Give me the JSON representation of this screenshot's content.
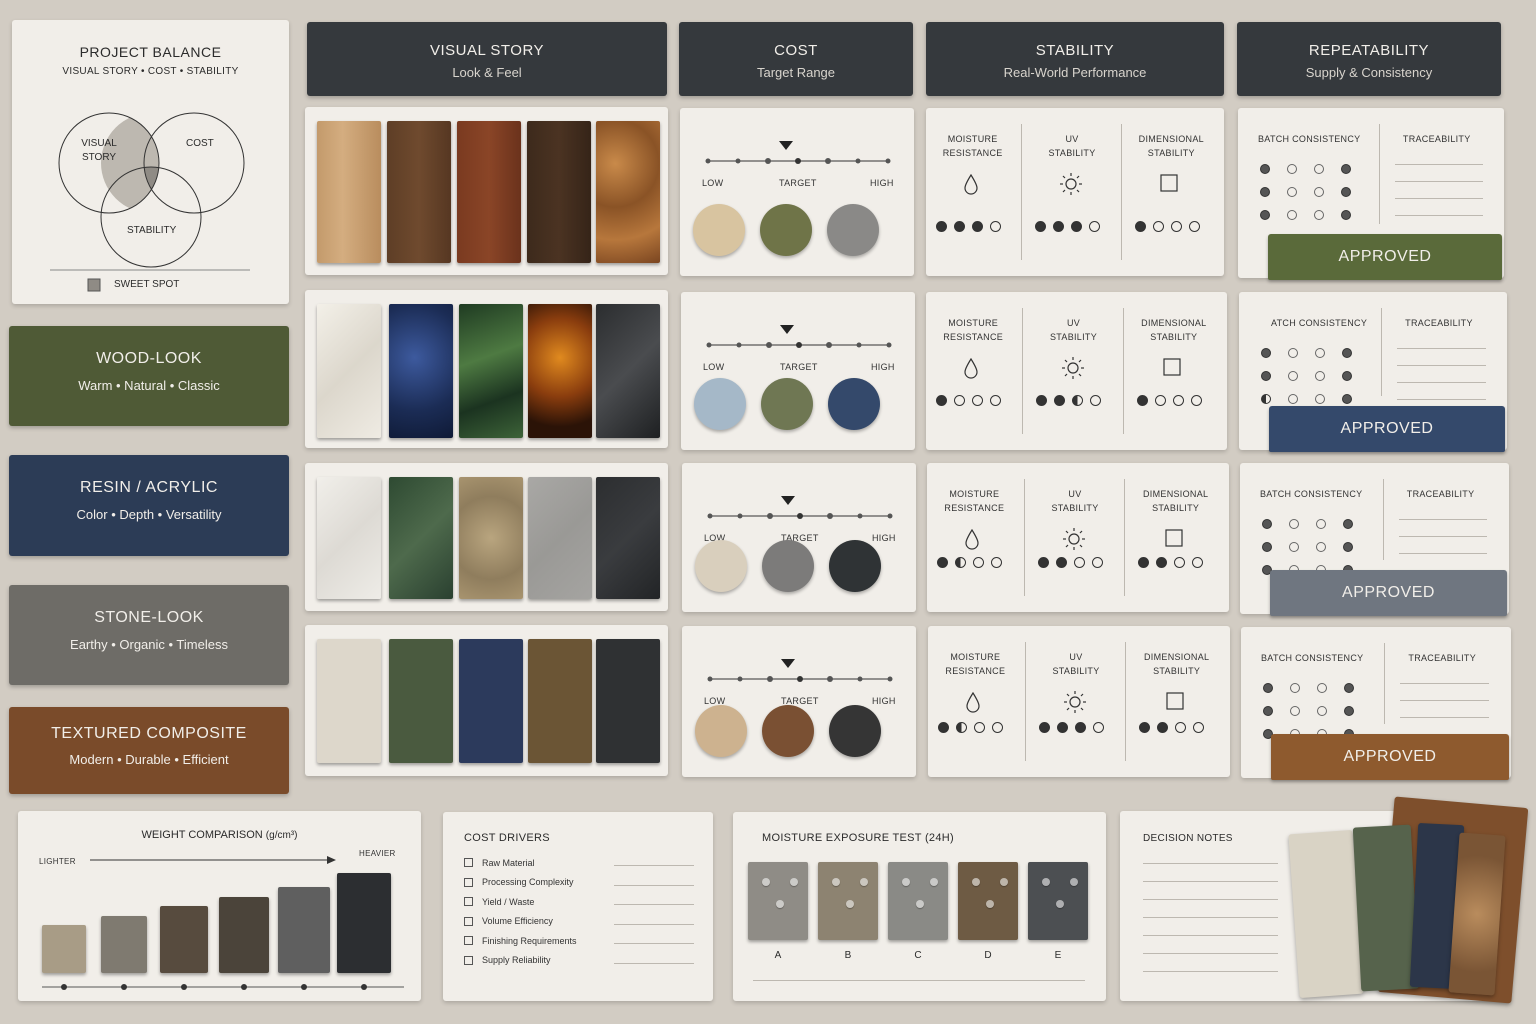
{
  "balance": {
    "title": "PROJECT BALANCE",
    "subtitle": "VISUAL STORY • COST • STABILITY",
    "circle_visual_line1": "VISUAL",
    "circle_visual_line2": "STORY",
    "circle_cost": "COST",
    "circle_stability": "STABILITY",
    "legend": "SWEET SPOT"
  },
  "headers": [
    {
      "title": "VISUAL STORY",
      "subtitle": "Look & Feel"
    },
    {
      "title": "COST",
      "subtitle": "Target Range"
    },
    {
      "title": "STABILITY",
      "subtitle": "Real-World Performance"
    },
    {
      "title": "REPEATABILITY",
      "subtitle": "Supply & Consistency"
    }
  ],
  "categories": [
    {
      "name": "WOOD-LOOK",
      "tagline": "Warm • Natural • Classic",
      "color": "#4f5a36"
    },
    {
      "name": "RESIN / ACRYLIC",
      "tagline": "Color • Depth • Versatility",
      "color": "#2c3c56"
    },
    {
      "name": "STONE-LOOK",
      "tagline": "Earthy • Organic • Timeless",
      "color": "#6e6c67"
    },
    {
      "name": "TEXTURED COMPOSITE",
      "tagline": "Modern • Durable • Efficient",
      "color": "#7a4b2a"
    }
  ],
  "cost_scale": {
    "low": "LOW",
    "target": "TARGET",
    "high": "HIGH"
  },
  "stability_labels": {
    "moisture_1": "MOISTURE",
    "moisture_2": "RESISTANCE",
    "uv_1": "UV",
    "uv_2": "STABILITY",
    "dim_1": "DIMENSIONAL",
    "dim_2": "STABILITY"
  },
  "stability_ratings": [
    {
      "moisture": 3,
      "uv": 3,
      "dimensional": 1
    },
    {
      "moisture": 1,
      "uv": 2.5,
      "dimensional": 1
    },
    {
      "moisture": 1.5,
      "uv": 2,
      "dimensional": 2
    },
    {
      "moisture": 1.5,
      "uv": 3,
      "dimensional": 2
    }
  ],
  "repeat_labels": {
    "batch": "BATCH CONSISTENCY",
    "batch_cropped": "ATCH CONSISTENCY",
    "trace": "TRACEABILITY"
  },
  "approved": [
    {
      "label": "APPROVED",
      "color": "#5a6a3a"
    },
    {
      "label": "APPROVED",
      "color": "#34496b"
    },
    {
      "label": "APPROVED",
      "color": "#6f7680"
    },
    {
      "label": "APPROVED",
      "color": "#8e5a2e"
    }
  ],
  "weight": {
    "title": "WEIGHT COMPARISON",
    "unit": "(g/cm³)",
    "lighter": "LIGHTER",
    "heavier": "HEAVIER",
    "relative_values": [
      1,
      1.2,
      1.4,
      1.6,
      1.8,
      2.1
    ]
  },
  "cost_drivers": {
    "title": "COST DRIVERS",
    "items": [
      "Raw Material",
      "Processing Complexity",
      "Yield / Waste",
      "Volume Efficiency",
      "Finishing Requirements",
      "Supply Reliability"
    ]
  },
  "moisture_test": {
    "title": "MOISTURE EXPOSURE TEST (24H)",
    "samples": [
      "A",
      "B",
      "C",
      "D",
      "E"
    ]
  },
  "decision_notes": {
    "title": "DECISION NOTES"
  }
}
